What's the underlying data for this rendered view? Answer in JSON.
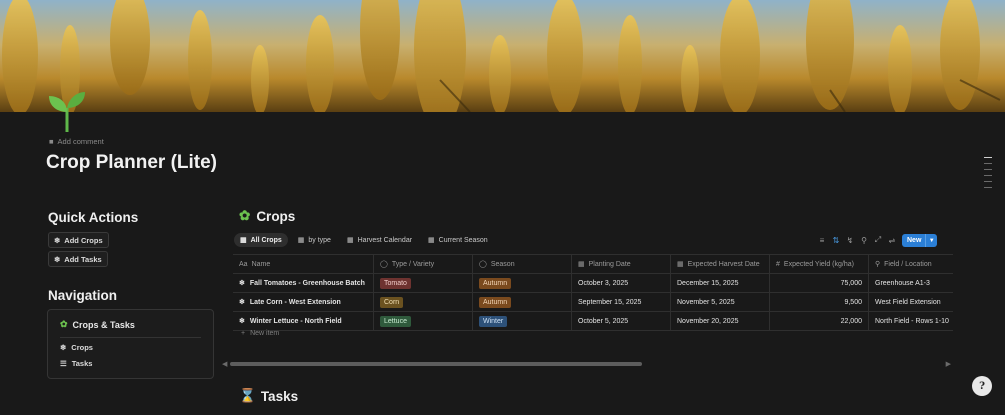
{
  "page": {
    "add_comment": "Add comment",
    "title": "Crop Planner (Lite)"
  },
  "quick_actions": {
    "heading": "Quick Actions",
    "buttons": [
      {
        "label": "Add Crops",
        "icon": "grain-icon"
      },
      {
        "label": "Add Tasks",
        "icon": "grain-icon"
      }
    ]
  },
  "navigation": {
    "heading": "Navigation",
    "box_title": "Crops & Tasks",
    "links": [
      {
        "label": "Crops",
        "icon": "grain-icon"
      },
      {
        "label": "Tasks",
        "icon": "checklist-icon"
      }
    ]
  },
  "crops_db": {
    "title": "Crops",
    "views": [
      "All Crops",
      "by type",
      "Harvest Calendar",
      "Current Season"
    ],
    "active_view": "All Crops",
    "new_label": "New",
    "columns": [
      "Name",
      "Type / Variety",
      "Season",
      "Planting Date",
      "Expected Harvest Date",
      "Expected Yield (kg/ha)",
      "Field / Location"
    ],
    "rows": [
      {
        "name": "Fall Tomatoes - Greenhouse Batch",
        "type": "Tomato",
        "season": "Autumn",
        "planting": "October 3, 2025",
        "harvest": "December 15, 2025",
        "yield": "75,000",
        "location": "Greenhouse A1-3"
      },
      {
        "name": "Late Corn - West Extension",
        "type": "Corn",
        "season": "Autumn",
        "planting": "September 15, 2025",
        "harvest": "November 5, 2025",
        "yield": "9,500",
        "location": "West Field Extension"
      },
      {
        "name": "Winter Lettuce - North Field",
        "type": "Lettuce",
        "season": "Winter",
        "planting": "October 5, 2025",
        "harvest": "November 20, 2025",
        "yield": "22,000",
        "location": "North Field - Rows 1-10"
      }
    ],
    "new_item": "New item"
  },
  "tasks_db": {
    "title": "Tasks"
  },
  "colors": {
    "tag_tomato": "#6e3330",
    "tag_corn": "#6b5220",
    "tag_autumn": "#7a4a1e",
    "tag_lettuce": "#2f5a3c",
    "tag_winter": "#2d5179",
    "accent": "#2b7fd6"
  }
}
